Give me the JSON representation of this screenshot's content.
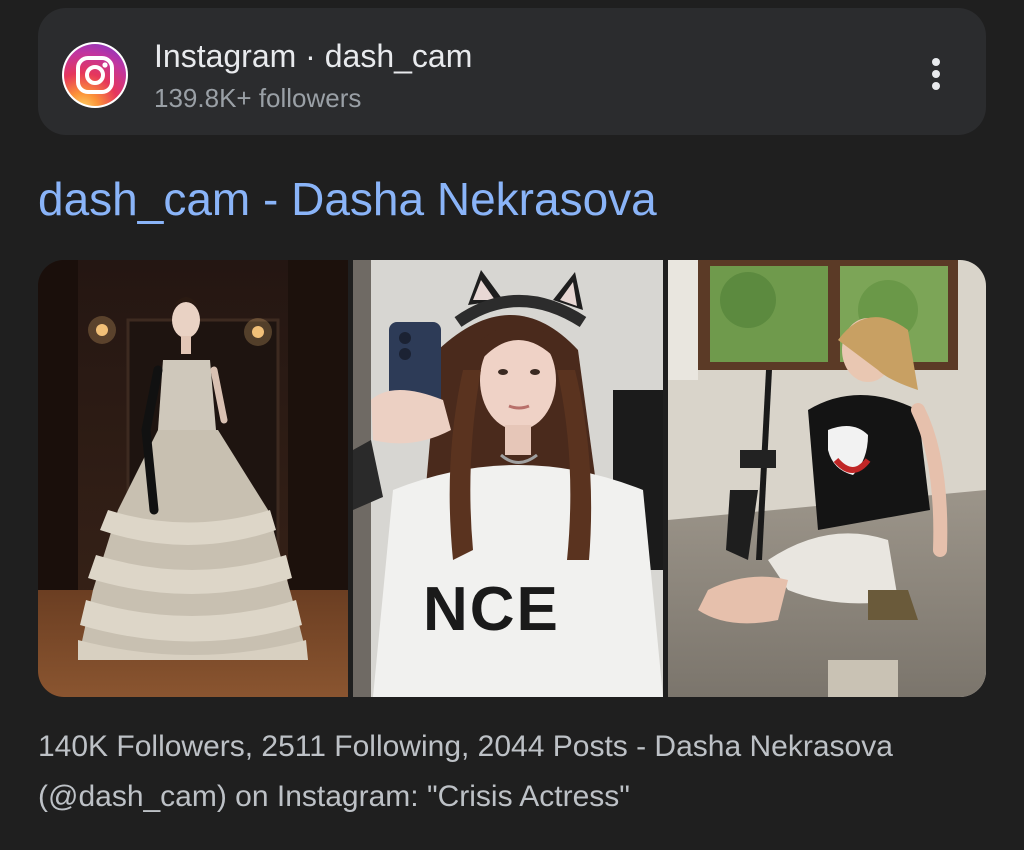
{
  "source": {
    "name": "Instagram · dash_cam",
    "followers": "139.8K+ followers",
    "icon": "instagram-icon",
    "more_icon": "more-vert-icon"
  },
  "result": {
    "title": "dash_cam - Dasha Nekrasova",
    "snippet": "140K Followers, 2511 Following, 2044 Posts - Dasha Nekrasova (@dash_cam) on Instagram: \"Crisis Actress\""
  },
  "images": [
    {
      "name": "photo-ball-gown"
    },
    {
      "name": "photo-mirror-selfie",
      "shirt_text": "NCE"
    },
    {
      "name": "photo-kneeling-room"
    }
  ],
  "colors": {
    "background": "#1f1f1f",
    "card": "#2b2c2e",
    "link": "#8ab4f8",
    "primary_text": "#e8eaed",
    "secondary_text": "#9aa0a6",
    "snippet_text": "#bdc1c6"
  }
}
